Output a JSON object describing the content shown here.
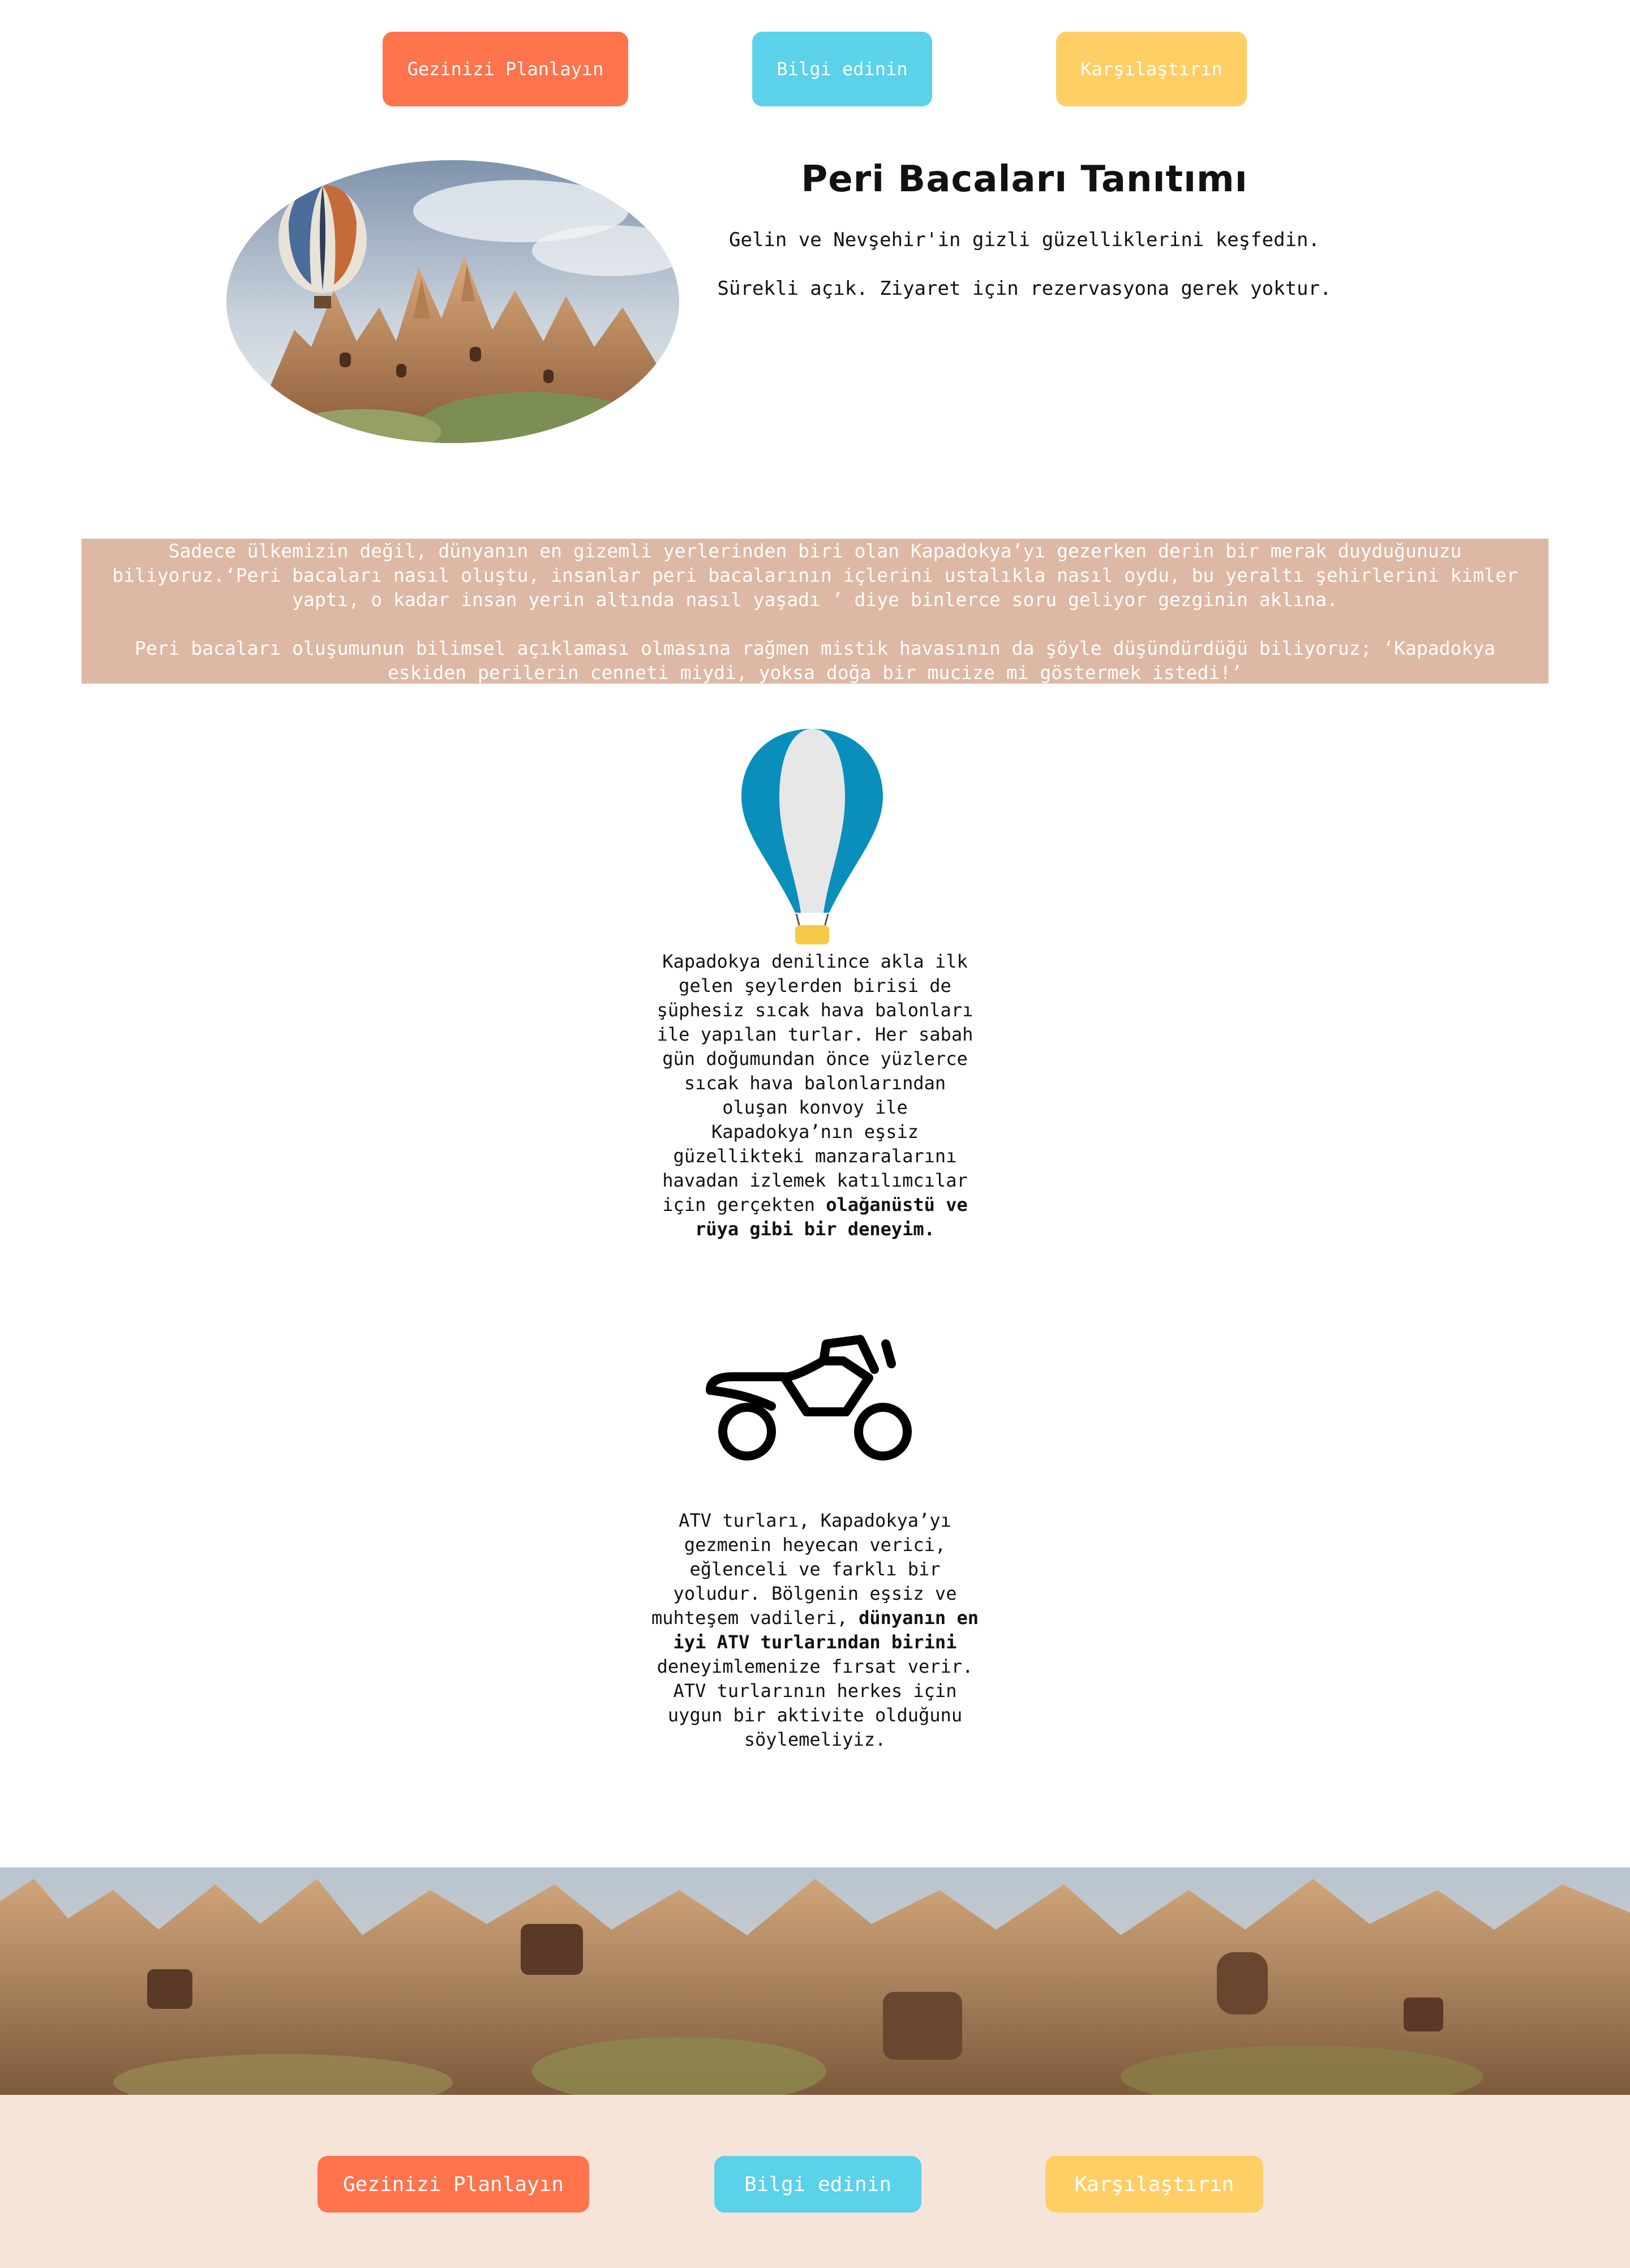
{
  "nav_top": {
    "plan": "Gezinizi Planlayın",
    "info": "Bilgi edinin",
    "compare": "Karşılaştırın"
  },
  "hero": {
    "title": "Peri Bacaları Tanıtımı",
    "subtitle": "Gelin ve Nevşehir'in gizli güzelliklerini keşfedin.",
    "note": "Sürekli açık. Ziyaret için rezervasyona gerek yoktur."
  },
  "intro": {
    "paragraph1": "Sadece ülkemizin değil, dünyanın en gizemli yerlerinden biri olan Kapadokya’yı gezerken derin bir merak duyduğunuzu biliyoruz.‘Peri bacaları nasıl oluştu, insanlar peri bacalarının içlerini ustalıkla nasıl oydu, bu yeraltı şehirlerini kimler yaptı, o kadar insan yerin altında nasıl yaşadı ’ diye binlerce soru geliyor gezginin aklına.",
    "paragraph2": "Peri bacaları oluşumunun bilimsel açıklaması olmasına rağmen mistik havasının da şöyle düşündürdüğü biliyoruz; ‘Kapadokya eskiden perilerin cenneti miydi, yoksa doğa bir mucize mi göstermek istedi!’"
  },
  "features": {
    "balloon": {
      "text": "Kapadokya denilince akla ilk gelen şeylerden birisi de şüphesiz sıcak hava balonları ile yapılan turlar. Her sabah gün doğumundan önce yüzlerce sıcak hava balonlarından oluşan konvoy ile Kapadokya’nın eşsiz güzellikteki manzaralarını havadan izlemek katılımcılar için gerçekten ",
      "bold": "olağanüstü ve rüya gibi bir deneyim."
    },
    "atv": {
      "text_before": "ATV turları, Kapadokya’yı gezmenin heyecan verici, eğlenceli ve farklı bir yoludur. Bölgenin eşsiz ve muhteşem vadileri, ",
      "bold": "dünyanın en iyi ATV turlarından birini",
      "text_after": " deneyimlemenize fırsat verir. ATV turlarının herkes için uygun bir aktivite olduğunu söylemeliyiz."
    }
  },
  "nav_bottom": {
    "plan": "Gezinizi Planlayın",
    "info": "Bilgi edinin",
    "compare": "Karşılaştırın"
  },
  "colors": {
    "orange": "#ff734d",
    "cyan": "#5bd1ea",
    "yellow": "#ffcf66",
    "intro_bg": "#ddb8a4",
    "footer_bg": "#f7e4d9"
  },
  "icons": {
    "hero": "balloon-over-fairy-chimneys-photo",
    "balloon": "hot-air-balloon-icon",
    "atv": "atv-motorbike-icon",
    "banner": "fairy-chimneys-landscape-photo"
  }
}
